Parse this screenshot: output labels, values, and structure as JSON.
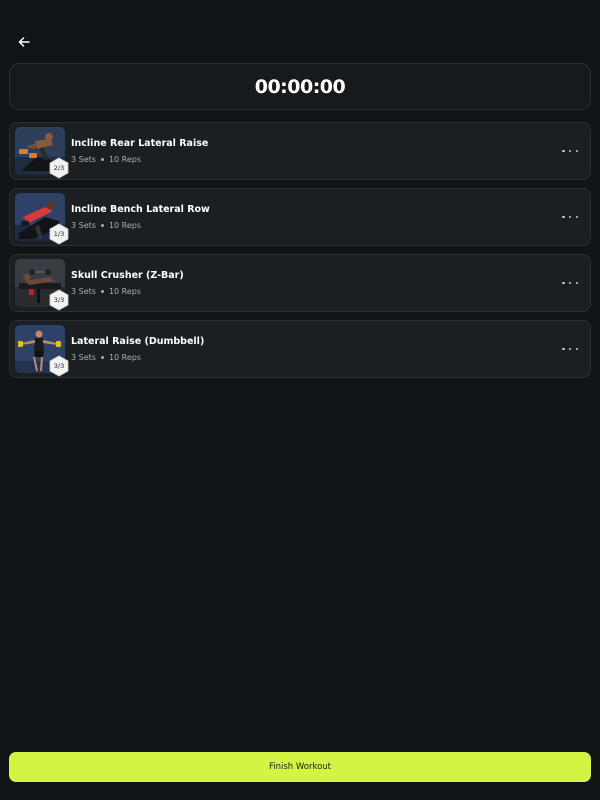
{
  "timer": {
    "value": "00:00:00"
  },
  "exercises": [
    {
      "name": "Incline Rear Lateral Raise",
      "sets": "3 Sets",
      "reps": "10 Reps",
      "progress": "2/3"
    },
    {
      "name": "Incline Bench Lateral Row",
      "sets": "3 Sets",
      "reps": "10 Reps",
      "progress": "1/3"
    },
    {
      "name": "Skull Crusher (Z-Bar)",
      "sets": "3 Sets",
      "reps": "10 Reps",
      "progress": "3/3"
    },
    {
      "name": "Lateral Raise (Dumbbell)",
      "sets": "3 Sets",
      "reps": "10 Reps",
      "progress": "3/3"
    }
  ],
  "footer": {
    "finish_label": "Finish Workout"
  },
  "icons": {
    "back": "arrow-left-icon",
    "more": "more-horizontal-icon",
    "badge": "hexagon-badge"
  },
  "colors": {
    "background": "#111416",
    "card": "#1b1f22",
    "accent": "#d4f444"
  }
}
